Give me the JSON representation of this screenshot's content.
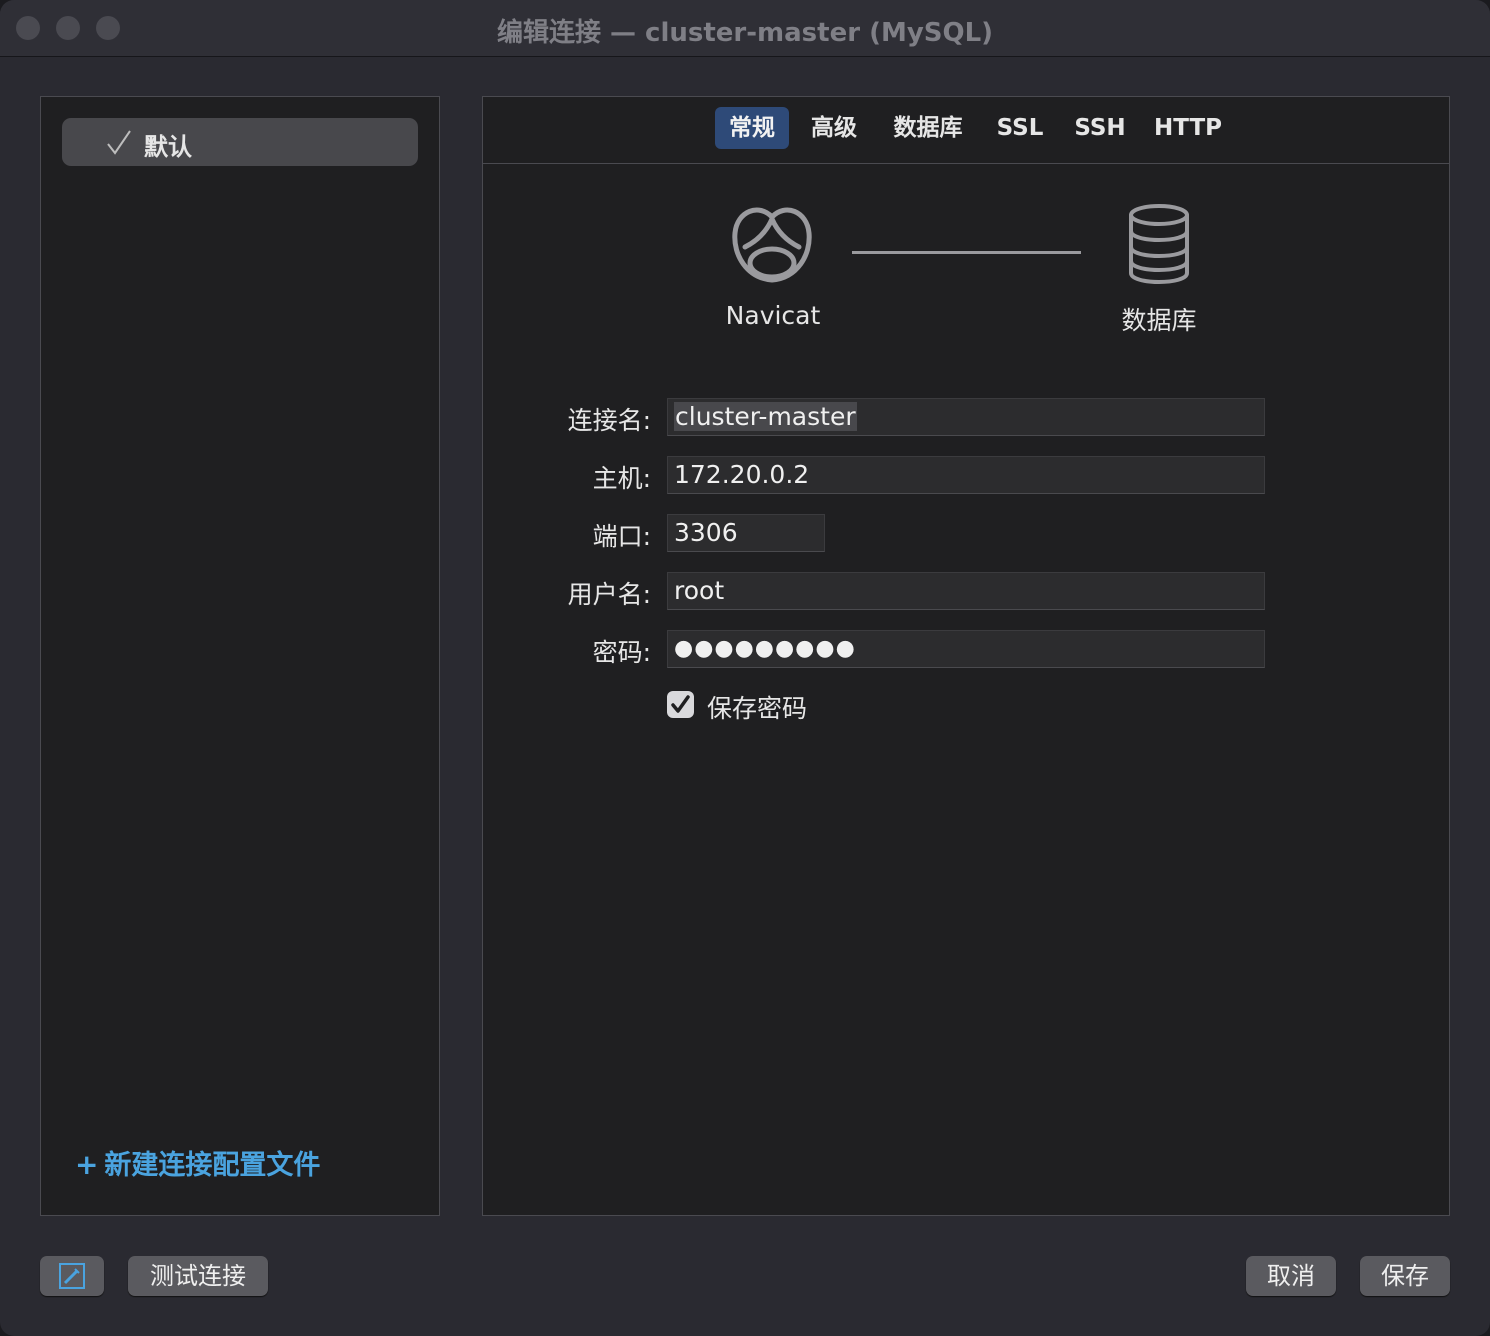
{
  "window": {
    "title": "编辑连接 — cluster-master (MySQL)"
  },
  "sidebar": {
    "profiles": [
      {
        "label": "默认",
        "checked": true
      }
    ],
    "new_profile_label": "新建连接配置文件",
    "new_profile_plus": "+"
  },
  "tabs": [
    {
      "label": "常规",
      "active": true
    },
    {
      "label": "高级",
      "active": false
    },
    {
      "label": "数据库",
      "active": false
    },
    {
      "label": "SSL",
      "active": false
    },
    {
      "label": "SSH",
      "active": false
    },
    {
      "label": "HTTP",
      "active": false
    }
  ],
  "diagram": {
    "left_label": "Navicat",
    "left_icon": "navicat-logo-icon",
    "right_label": "数据库",
    "right_icon": "database-icon"
  },
  "form": {
    "connection_name": {
      "label": "连接名:",
      "value": "cluster-master"
    },
    "host": {
      "label": "主机:",
      "value": "172.20.0.2"
    },
    "port": {
      "label": "端口:",
      "value": "3306"
    },
    "username": {
      "label": "用户名:",
      "value": "root"
    },
    "password": {
      "label": "密码:",
      "value": "●●●●●●●●●"
    },
    "save_password": {
      "label": "保存密码",
      "checked": true
    }
  },
  "footer": {
    "config_icon": "edit-config-icon",
    "test_label": "测试连接",
    "cancel_label": "取消",
    "save_label": "保存"
  },
  "colors": {
    "accent_tab": "#2e4a78",
    "link": "#4aa3df",
    "window_bg": "#2a2a31",
    "panel_bg": "#1f1f21"
  }
}
